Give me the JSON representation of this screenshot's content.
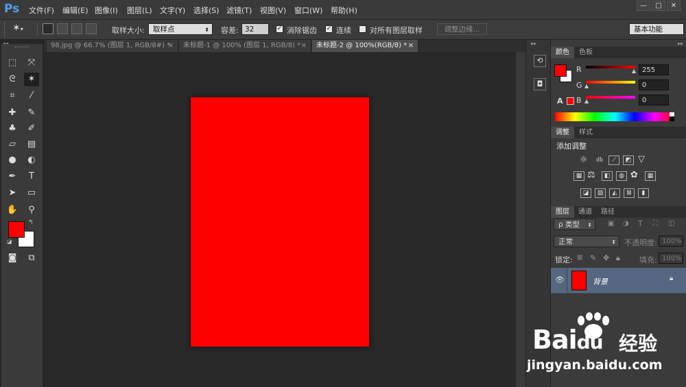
{
  "app": {
    "logo": "Ps"
  },
  "menu": [
    "文件(F)",
    "编辑(E)",
    "图像(I)",
    "图层(L)",
    "文字(Y)",
    "选择(S)",
    "滤镜(T)",
    "视图(V)",
    "窗口(W)",
    "帮助(H)"
  ],
  "window_controls": [
    "—",
    "□",
    "✕"
  ],
  "options": {
    "sample_size_label": "取样大小:",
    "sample_size_value": "取样点",
    "tolerance_label": "容差:",
    "tolerance_value": "32",
    "anti_alias_label": "消除锯齿",
    "anti_alias_checked": true,
    "contiguous_label": "连续",
    "contiguous_checked": true,
    "all_layers_label": "对所有图层取样",
    "all_layers_checked": false,
    "refine_edge_label": "调整边缘...",
    "workspace_value": "基本功能"
  },
  "tabs": [
    {
      "label": "98.jpg @ 66.7% (图层 1, RGB/8#) *",
      "active": false
    },
    {
      "label": "未标题-1 @ 100% (图层 1, RGB/8) *",
      "active": false
    },
    {
      "label": "未标题-2 @ 100%(RGB/8) *",
      "active": true
    }
  ],
  "tab_close": "×",
  "colors": {
    "foreground": "#ff0000",
    "background": "#ffffff",
    "document_fill": "#ff0000"
  },
  "color_panel": {
    "tabs": [
      "颜色",
      "色板"
    ],
    "channels": [
      {
        "label": "R",
        "value": "255"
      },
      {
        "label": "G",
        "value": "0"
      },
      {
        "label": "B",
        "value": "0"
      }
    ],
    "warning_glyph": "A"
  },
  "adjustments_panel": {
    "tabs": [
      "调整",
      "样式"
    ],
    "title": "添加调整"
  },
  "layers_panel": {
    "tabs": [
      "图层",
      "通道",
      "路径"
    ],
    "filter_label": "ρ 类型",
    "blend_mode": "正常",
    "opacity_label": "不透明度:",
    "opacity_value": "100%",
    "lock_label": "锁定:",
    "fill_label": "填充:",
    "fill_value": "100%",
    "layers": [
      {
        "name": "背景",
        "visible": true,
        "locked": true
      }
    ]
  },
  "watermark": {
    "brand_latin": "Bai",
    "brand_du": "du",
    "brand_cn": "经验",
    "url": "jingyan.baidu.com"
  }
}
